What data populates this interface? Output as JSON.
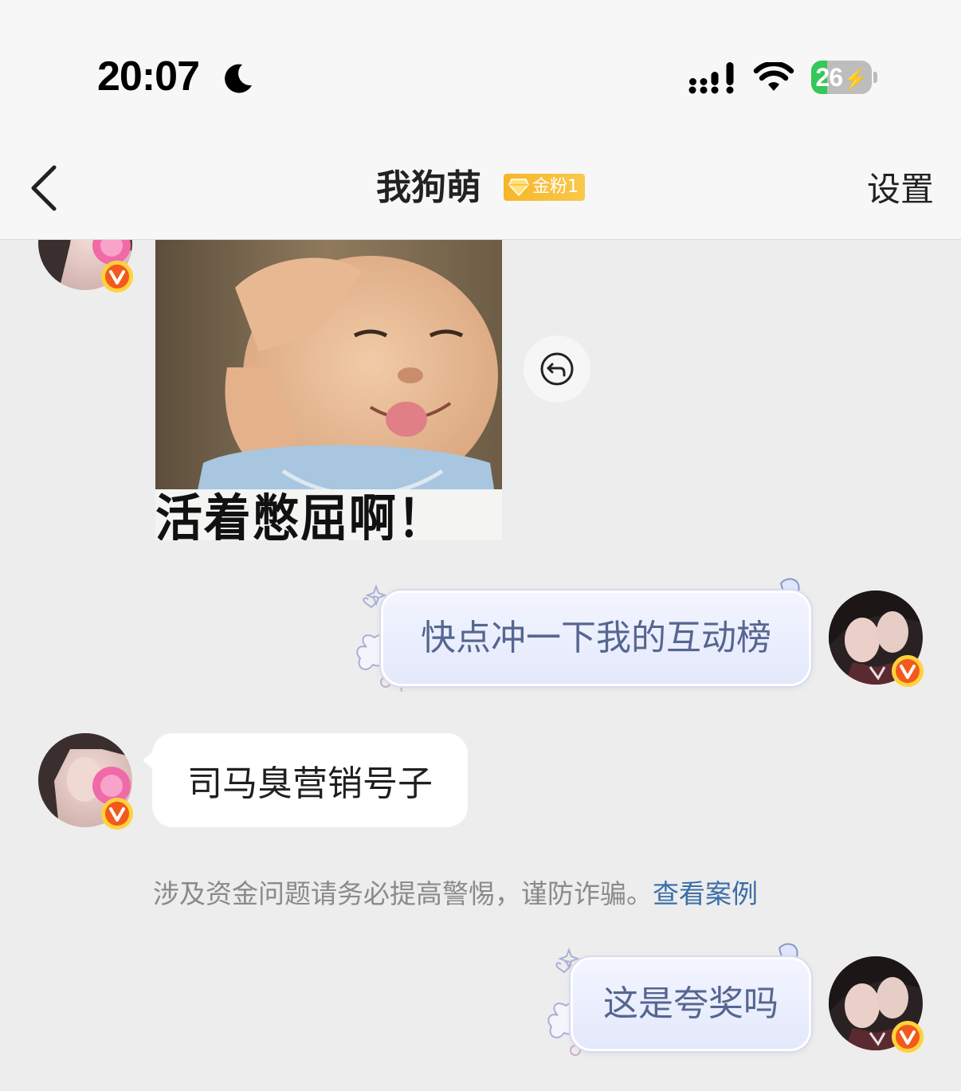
{
  "status_bar": {
    "time": "20:07",
    "battery_level": "26",
    "battery_fraction": 0.26,
    "icons": [
      "moon-icon",
      "signal-icon",
      "wifi-icon",
      "battery-charging-icon"
    ]
  },
  "nav": {
    "back_icon": "chevron-left-icon",
    "title": "我狗萌",
    "fan_badge": "金粉1",
    "settings": "设置"
  },
  "colors": {
    "background": "#ededed",
    "badge": "#f6b62a",
    "fancy_bubble_text": "#556690",
    "link": "#3b6ea8",
    "verified": "#f25a1c"
  },
  "messages": [
    {
      "side": "left",
      "type": "image",
      "caption": "活着憋屈啊！"
    },
    {
      "side": "right",
      "type": "text",
      "text": "快点冲一下我的互动榜"
    },
    {
      "side": "left",
      "type": "text",
      "text": "司马臭营销号子"
    },
    {
      "side": "right",
      "type": "text",
      "text": "这是夸奖吗"
    }
  ],
  "notice": {
    "text": "涉及资金问题请务必提高警惕，谨防诈骗。",
    "link": "查看案例"
  }
}
